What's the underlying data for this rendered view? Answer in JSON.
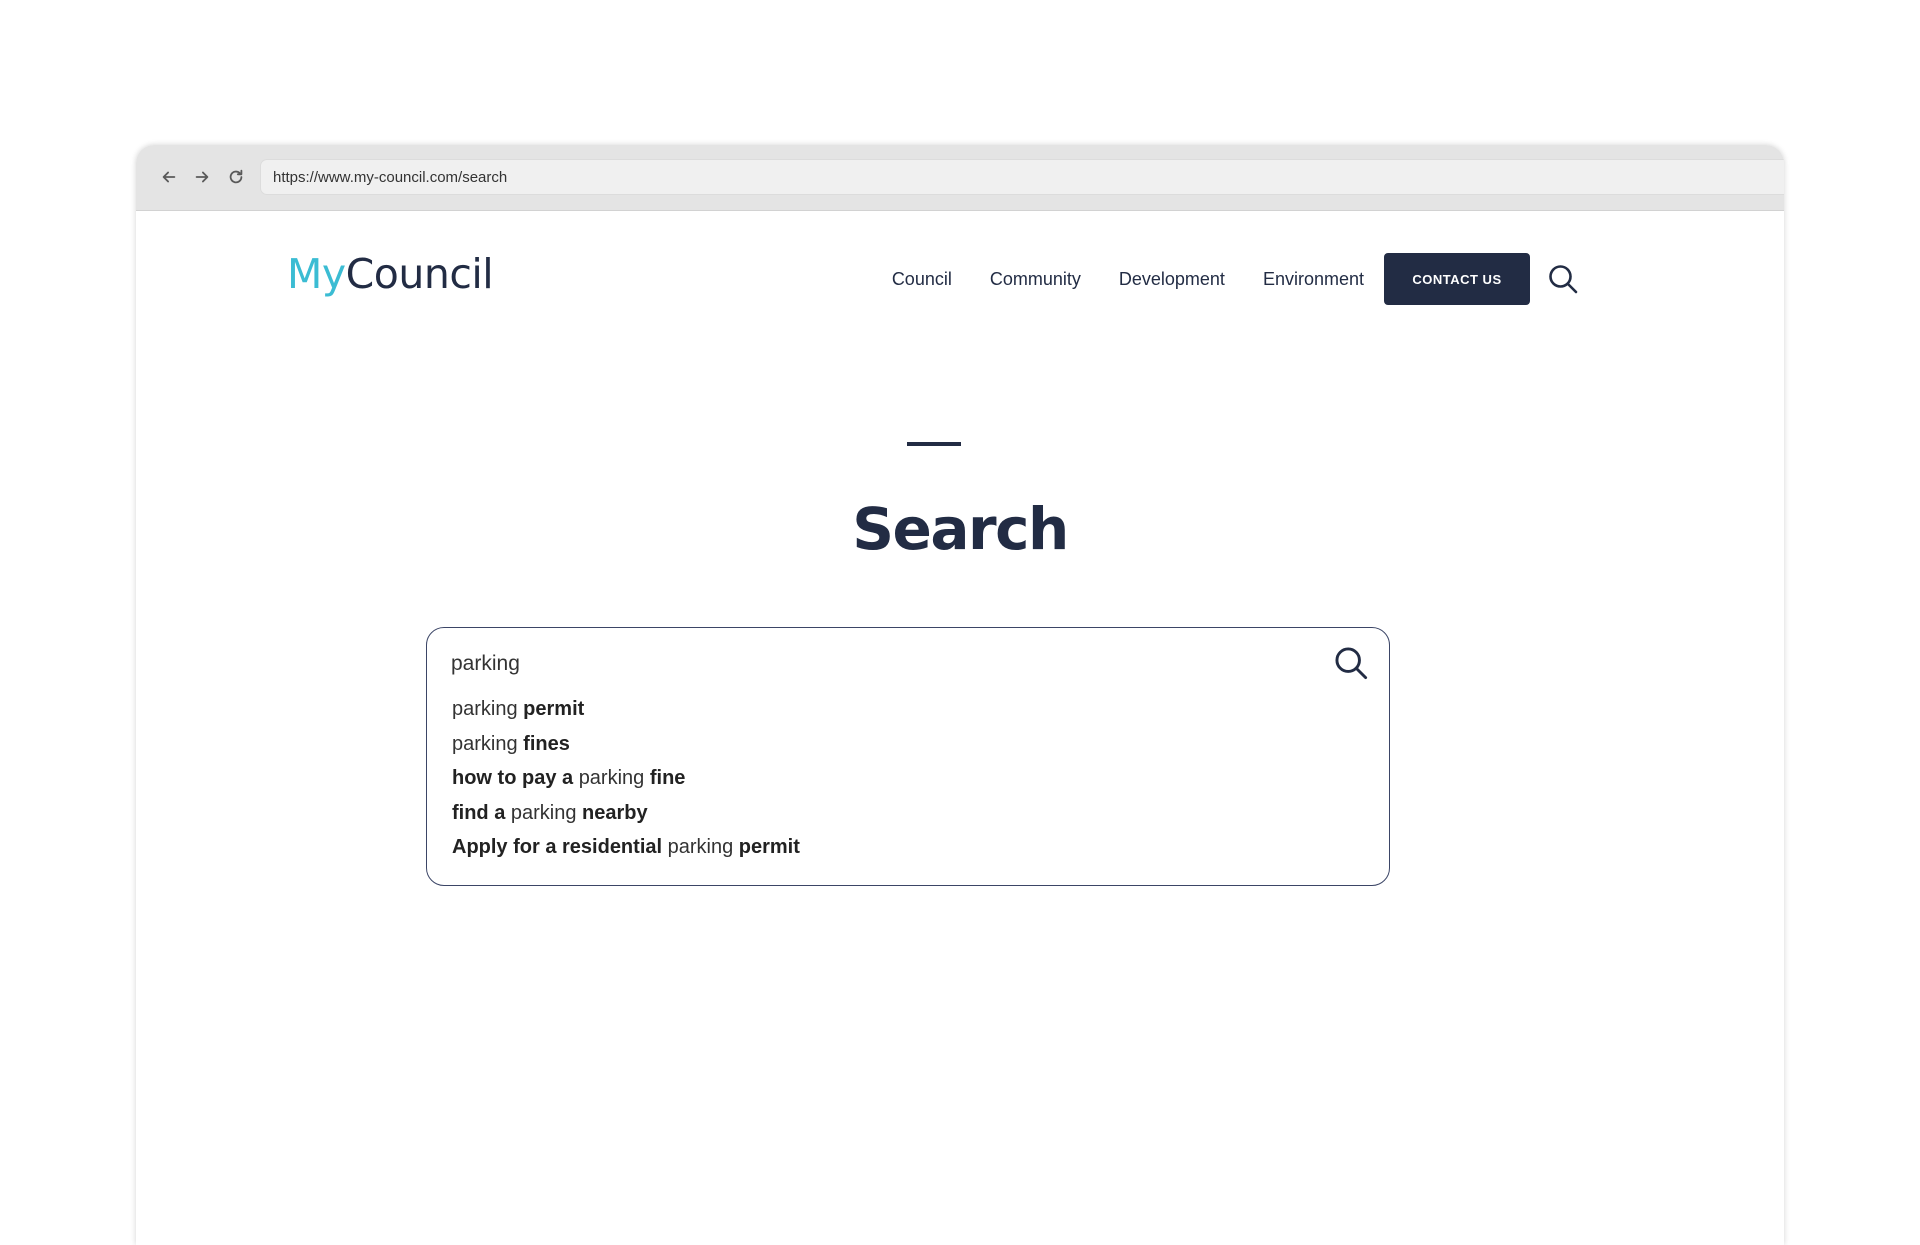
{
  "browser": {
    "url": "https://www.my-council.com/search",
    "icons": [
      "back-arrow-icon",
      "forward-arrow-icon",
      "reload-icon"
    ]
  },
  "header": {
    "logo_part1": "My",
    "logo_part2": "Council",
    "nav": [
      {
        "label": "Council"
      },
      {
        "label": "Community"
      },
      {
        "label": "Development"
      },
      {
        "label": "Environment"
      }
    ],
    "contact_label": "CONTACT US"
  },
  "page": {
    "title": "Search"
  },
  "search": {
    "value": "parking",
    "suggestions": [
      {
        "before": "",
        "match": "parking",
        "after": " permit"
      },
      {
        "before": "",
        "match": "parking",
        "after": " fines"
      },
      {
        "before": "how to pay a ",
        "match": "parking",
        "after": " fine"
      },
      {
        "before": "find a ",
        "match": "parking",
        "after": " nearby"
      },
      {
        "before": "Apply for a residential ",
        "match": "parking",
        "after": " permit"
      }
    ]
  },
  "colors": {
    "brand_navy": "#222c44",
    "brand_cyan": "#3bbcd3",
    "chrome_bg": "#e4e4e4"
  }
}
